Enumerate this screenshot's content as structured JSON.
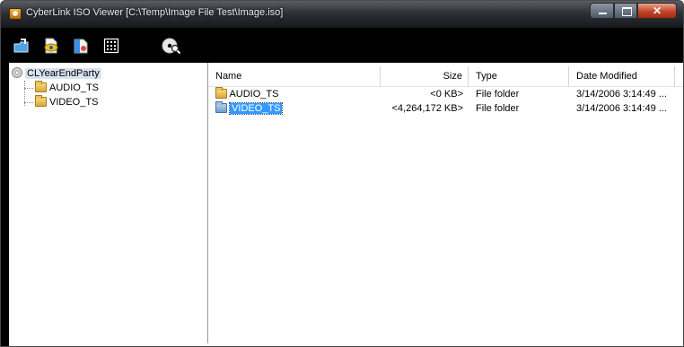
{
  "window": {
    "title": "CyberLink ISO Viewer [C:\\Temp\\Image File Test\\Image.iso]",
    "controls": {
      "minimize": "minimize-icon",
      "maximize": "maximize-icon",
      "close": "✕"
    }
  },
  "toolbar": {
    "buttons": [
      {
        "name": "open-icon"
      },
      {
        "name": "burn-icon"
      },
      {
        "name": "extract-icon"
      },
      {
        "name": "grid-icon"
      },
      {
        "name": "disc-search-icon"
      }
    ]
  },
  "tree": {
    "root": "CLYearEndParty",
    "children": [
      "AUDIO_TS",
      "VIDEO_TS"
    ]
  },
  "list": {
    "columns": [
      "Name",
      "Size",
      "Type",
      "Date Modified"
    ],
    "rows": [
      {
        "name": "AUDIO_TS",
        "size": "<0 KB>",
        "type": "File folder",
        "date": "3/14/2006 3:14:49 ...",
        "selected": false
      },
      {
        "name": "VIDEO_TS",
        "size": "<4,264,172 KB>",
        "type": "File folder",
        "date": "3/14/2006 3:14:49 ...",
        "selected": true
      }
    ]
  },
  "colors": {
    "selection": "#3399ff",
    "toolbar_bg": "#000000",
    "folder": "#e9c35c"
  }
}
